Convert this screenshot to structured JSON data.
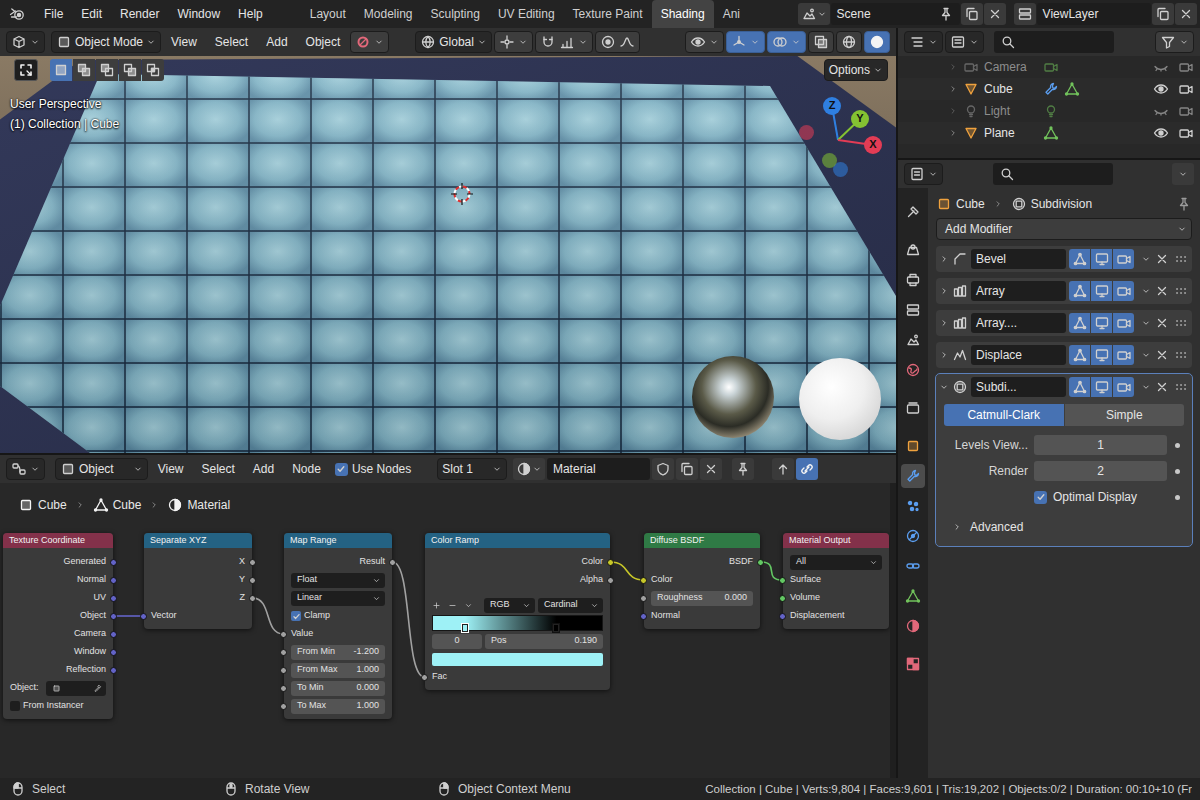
{
  "topbar": {
    "menus": [
      "File",
      "Edit",
      "Render",
      "Window",
      "Help"
    ],
    "workspaces": [
      {
        "label": "Layout",
        "selected": false
      },
      {
        "label": "Modeling",
        "selected": false
      },
      {
        "label": "Sculpting",
        "selected": false
      },
      {
        "label": "UV Editing",
        "selected": false
      },
      {
        "label": "Texture Paint",
        "selected": false
      },
      {
        "label": "Shading",
        "selected": true
      },
      {
        "label": "Ani",
        "selected": false
      }
    ],
    "scene": "Scene",
    "view_layer": "ViewLayer"
  },
  "viewport": {
    "mode": "Object Mode",
    "menus": [
      "View",
      "Select",
      "Add",
      "Object"
    ],
    "orientation": "Global",
    "header_toggles": [
      {
        "kind": "visibility",
        "on": false
      },
      {
        "kind": "gizmo",
        "on": true
      },
      {
        "kind": "overlay",
        "on": true
      },
      {
        "kind": "xray",
        "on": false
      },
      {
        "kind": "wireframe",
        "on": false
      },
      {
        "kind": "solid",
        "on": true
      }
    ],
    "select_modes": [
      {
        "kind": "set",
        "selected": true
      },
      {
        "kind": "extend",
        "selected": false
      },
      {
        "kind": "subtract",
        "selected": false
      },
      {
        "kind": "difference",
        "selected": false
      },
      {
        "kind": "intersect",
        "selected": false
      }
    ],
    "options": "Options",
    "info": [
      "User Perspective",
      "(1) Collection | Cube"
    ],
    "axes": [
      {
        "label": "Z",
        "color": "#2f7fe0"
      },
      {
        "label": "Y",
        "color": "#84c232"
      },
      {
        "label": "X",
        "color": "#e33c55"
      }
    ]
  },
  "node_editor": {
    "type": "Object",
    "menus": [
      "View",
      "Select",
      "Add",
      "Node"
    ],
    "use_nodes": {
      "label": "Use Nodes",
      "checked": true
    },
    "slot": "Slot 1",
    "material": "Material",
    "breadcrumb": [
      "Cube",
      "Cube",
      "Material"
    ],
    "nodes": [
      {
        "title": "Texture Coordinate",
        "color": "#83314a",
        "rows": [
          {
            "kind": "output",
            "label": "Generated",
            "socket": "vector"
          },
          {
            "kind": "output",
            "label": "Normal",
            "socket": "vector"
          },
          {
            "kind": "output",
            "label": "UV",
            "socket": "vector"
          },
          {
            "kind": "output",
            "label": "Object",
            "socket": "vector"
          },
          {
            "kind": "output",
            "label": "Camera",
            "socket": "vector"
          },
          {
            "kind": "output",
            "label": "Window",
            "socket": "vector"
          },
          {
            "kind": "output",
            "label": "Reflection",
            "socket": "vector"
          },
          {
            "kind": "object",
            "label": "Object:"
          },
          {
            "kind": "checkbox",
            "label": "From Instancer",
            "checked": false
          }
        ]
      },
      {
        "title": "Separate XYZ",
        "color": "#246283",
        "rows": [
          {
            "kind": "output",
            "label": "X",
            "socket": "float"
          },
          {
            "kind": "output",
            "label": "Y",
            "socket": "float"
          },
          {
            "kind": "output",
            "label": "Z",
            "socket": "float"
          },
          {
            "kind": "input",
            "label": "Vector",
            "socket": "vector"
          }
        ]
      },
      {
        "title": "Map Range",
        "color": "#246283",
        "rows": [
          {
            "kind": "output",
            "label": "Result",
            "socket": "float"
          },
          {
            "kind": "select",
            "label": "Float"
          },
          {
            "kind": "select",
            "label": "Linear"
          },
          {
            "kind": "checkbox",
            "label": "Clamp",
            "checked": true
          },
          {
            "kind": "input",
            "label": "Value",
            "socket": "float"
          },
          {
            "kind": "field",
            "label": "From Min",
            "value": "-1.200",
            "socket": "float"
          },
          {
            "kind": "field",
            "label": "From Max",
            "value": "1.000",
            "socket": "float"
          },
          {
            "kind": "field",
            "label": "To Min",
            "value": "0.000",
            "socket": "float"
          },
          {
            "kind": "field",
            "label": "To Max",
            "value": "1.000",
            "socket": "float"
          }
        ]
      },
      {
        "title": "Color Ramp",
        "color": "#246283",
        "rows": [
          {
            "kind": "output",
            "label": "Color",
            "socket": "color"
          },
          {
            "kind": "output",
            "label": "Alpha",
            "socket": "float"
          },
          {
            "kind": "ramp_tools",
            "mode": "RGB",
            "interpolation": "Cardinal"
          },
          {
            "kind": "ramp",
            "stops": [
              {
                "pos": 0.19,
                "color": "#9ef1f6",
                "selected": true
              },
              {
                "pos": 0.73,
                "color": "#000000",
                "selected": false
              }
            ]
          },
          {
            "kind": "stop_info",
            "index": "0",
            "pos_label": "Pos",
            "pos_value": "0.190"
          },
          {
            "kind": "swatch",
            "color": "#9ef1f6"
          },
          {
            "kind": "input",
            "label": "Fac",
            "socket": "float"
          }
        ]
      },
      {
        "title": "Diffuse BSDF",
        "color": "#2f7a45",
        "rows": [
          {
            "kind": "output",
            "label": "BSDF",
            "socket": "shader"
          },
          {
            "kind": "input",
            "label": "Color",
            "socket": "color"
          },
          {
            "kind": "field",
            "label": "Roughness",
            "value": "0.000",
            "socket": "float"
          },
          {
            "kind": "input",
            "label": "Normal",
            "socket": "vector"
          }
        ]
      },
      {
        "title": "Material Output",
        "color": "#83314a",
        "rows": [
          {
            "kind": "select",
            "label": "All"
          },
          {
            "kind": "input",
            "label": "Surface",
            "socket": "shader"
          },
          {
            "kind": "input",
            "label": "Volume",
            "socket": "shader"
          },
          {
            "kind": "input",
            "label": "Displacement",
            "socket": "vector"
          }
        ]
      }
    ],
    "links": [
      {
        "from": [
          0,
          3
        ],
        "to": [
          1,
          3
        ]
      },
      {
        "from": [
          1,
          2
        ],
        "to": [
          2,
          4
        ]
      },
      {
        "from": [
          2,
          0
        ],
        "to": [
          3,
          6
        ]
      },
      {
        "from": [
          3,
          0
        ],
        "to": [
          4,
          1
        ]
      },
      {
        "from": [
          4,
          0
        ],
        "to": [
          5,
          1
        ]
      }
    ]
  },
  "outliner": {
    "items": [
      {
        "name": "Camera",
        "kind": "camera",
        "dimmed": true,
        "visible": false,
        "modifiers": false
      },
      {
        "name": "Cube",
        "kind": "mesh",
        "dimmed": false,
        "visible": true,
        "modifiers": true
      },
      {
        "name": "Light",
        "kind": "light",
        "dimmed": true,
        "visible": false,
        "modifiers": false
      },
      {
        "name": "Plane",
        "kind": "mesh",
        "dimmed": false,
        "visible": true,
        "modifiers": false
      }
    ]
  },
  "properties": {
    "tabs": [
      {
        "kind": "tool",
        "selected": false
      },
      {
        "kind": "render",
        "selected": false
      },
      {
        "kind": "output",
        "selected": false
      },
      {
        "kind": "view_layer",
        "selected": false
      },
      {
        "kind": "scene",
        "selected": false
      },
      {
        "kind": "world",
        "selected": false
      },
      {
        "kind": "collection",
        "selected": false
      },
      {
        "kind": "object",
        "selected": false
      },
      {
        "kind": "modifiers",
        "selected": true
      },
      {
        "kind": "particles",
        "selected": false
      },
      {
        "kind": "physics",
        "selected": false
      },
      {
        "kind": "constraints",
        "selected": false
      },
      {
        "kind": "data",
        "selected": false
      },
      {
        "kind": "material",
        "selected": false
      },
      {
        "kind": "texture",
        "selected": false
      }
    ],
    "breadcrumb": [
      "Cube",
      "Subdivision"
    ],
    "add_modifier": "Add Modifier",
    "modifiers": [
      {
        "name": "Bevel",
        "kind": "bevel",
        "expanded": false,
        "active": false,
        "toggles": [
          true,
          true,
          true
        ]
      },
      {
        "name": "Array",
        "kind": "array",
        "expanded": false,
        "active": false,
        "toggles": [
          true,
          true,
          true
        ]
      },
      {
        "name": "Array....",
        "kind": "array",
        "expanded": false,
        "active": false,
        "toggles": [
          true,
          true,
          true
        ]
      },
      {
        "name": "Displace",
        "kind": "displace",
        "expanded": false,
        "active": false,
        "toggles": [
          true,
          true,
          true
        ]
      },
      {
        "name": "Subdi...",
        "kind": "subdivision",
        "expanded": true,
        "active": true,
        "toggles": [
          true,
          true,
          true
        ]
      }
    ],
    "subdivision": {
      "types": [
        {
          "label": "Catmull-Clark",
          "selected": true
        },
        {
          "label": "Simple",
          "selected": false
        }
      ],
      "fields": [
        {
          "label": "Levels View...",
          "value": "1"
        },
        {
          "label": "Render",
          "value": "2"
        }
      ],
      "optimal_display": {
        "label": "Optimal Display",
        "checked": true
      },
      "advanced": {
        "label": "Advanced",
        "expanded": false
      }
    }
  },
  "status_bar": {
    "hints": [
      {
        "label": "Select",
        "kind": "left"
      },
      {
        "label": "Rotate View",
        "kind": "middle"
      },
      {
        "label": "Object Context Menu",
        "kind": "right"
      }
    ],
    "stats": "Collection | Cube | Verts:9,804 | Faces:9,601 | Tris:19,202 | Objects:0/2 | Duration: 00:10+10 (Fr"
  }
}
